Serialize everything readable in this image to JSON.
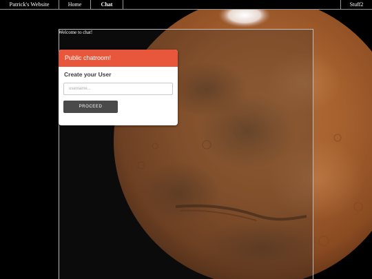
{
  "nav": {
    "brand": "Patrick's Website",
    "items": [
      {
        "label": "Home",
        "active": false
      },
      {
        "label": "Chat",
        "active": true
      }
    ],
    "right_item": "Stuff2"
  },
  "chat": {
    "welcome_text": "Welcome to chat!"
  },
  "login_card": {
    "header": "Public chatroom!",
    "title": "Create your User",
    "username_placeholder": "username...",
    "username_value": "",
    "proceed_label": "PROCEED"
  },
  "colors": {
    "accent_header": "#e8573b",
    "button_bg": "#4a4a4a",
    "page_bg": "#000000"
  },
  "background_image": "mars-globe"
}
